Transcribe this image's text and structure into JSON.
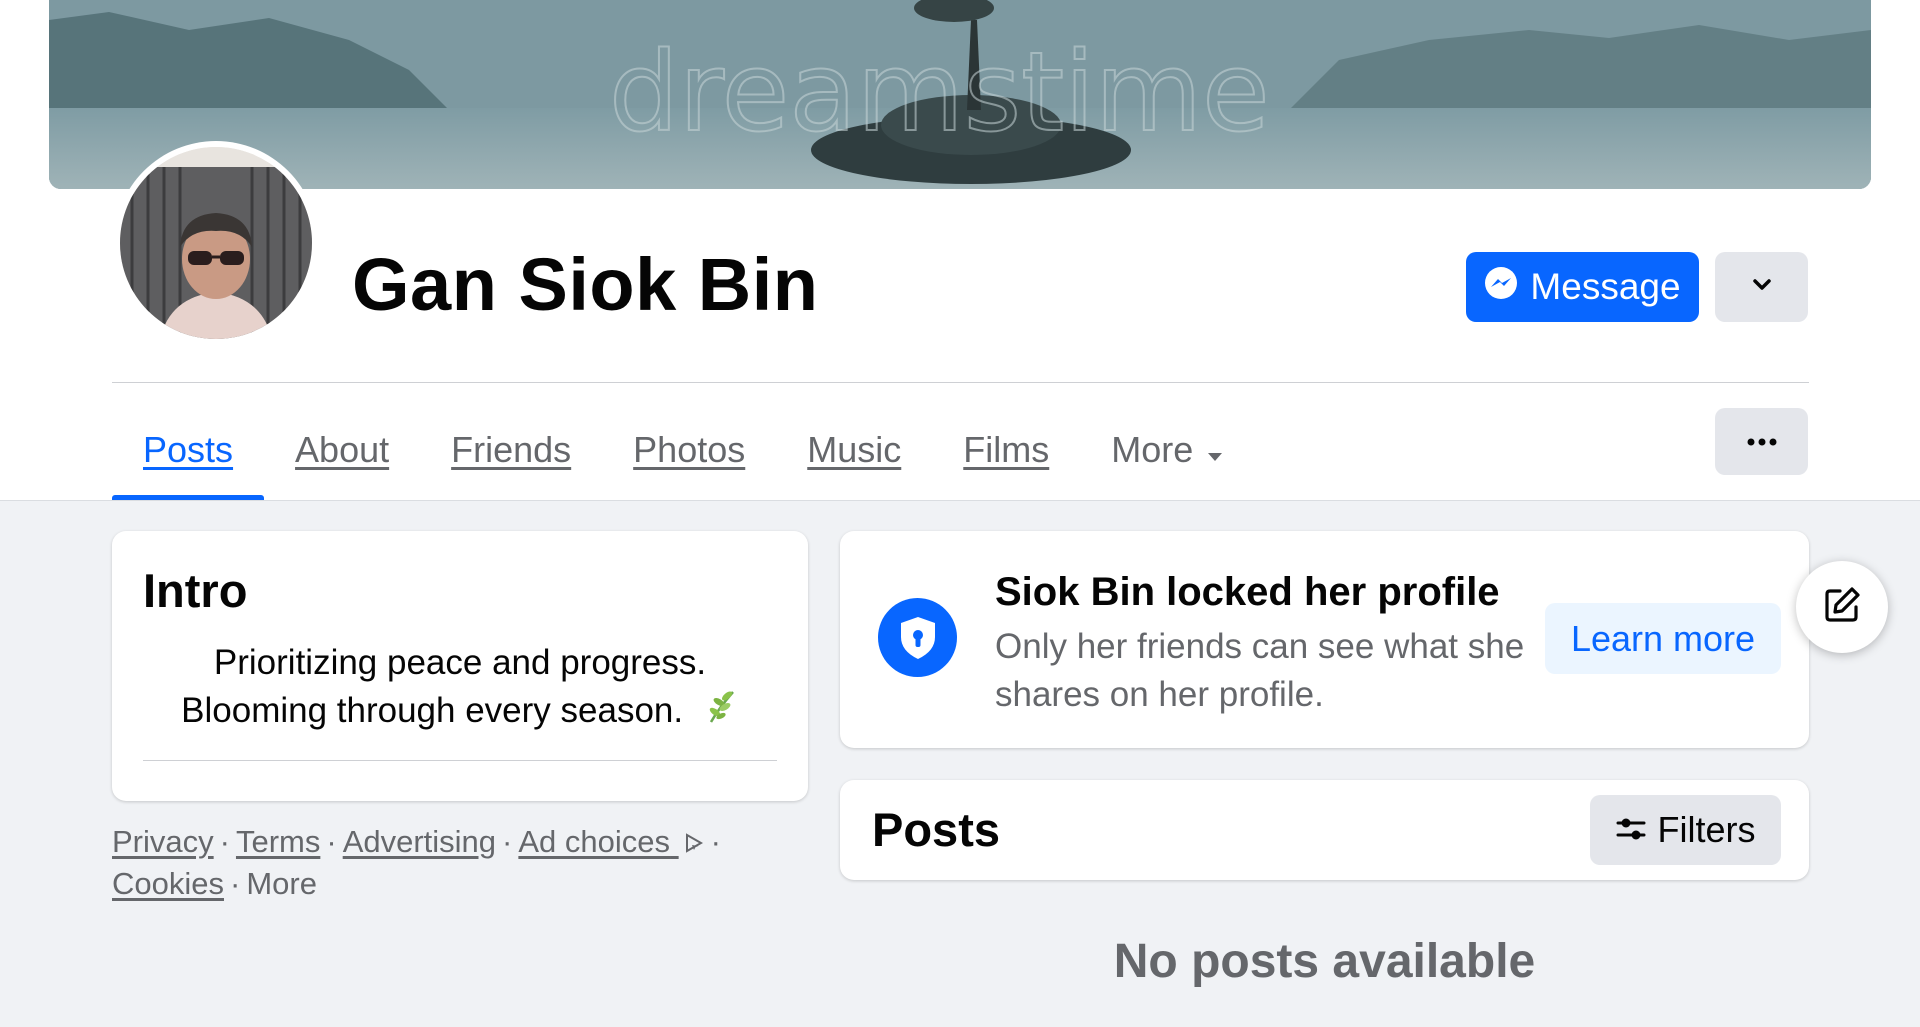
{
  "profile": {
    "name": "Gan Siok Bin",
    "cover_watermark": "dreamstime"
  },
  "actions": {
    "message_label": "Message",
    "message_icon": "messenger-icon",
    "dropdown_icon": "chevron-down-icon",
    "more_options_icon": "ellipsis-icon"
  },
  "tabs": [
    {
      "label": "Posts",
      "active": true
    },
    {
      "label": "About"
    },
    {
      "label": "Friends"
    },
    {
      "label": "Photos"
    },
    {
      "label": "Music"
    },
    {
      "label": "Films"
    },
    {
      "label": "More"
    }
  ],
  "intro": {
    "title": "Intro",
    "bio_line1": "Prioritizing peace and progress.",
    "bio_line2": "Blooming through every season.",
    "bio_emoji": "herb-icon"
  },
  "footer": {
    "links": [
      "Privacy",
      "Terms",
      "Advertising",
      "Ad choices",
      "Cookies"
    ],
    "more": "More",
    "separator": "·"
  },
  "locked": {
    "title": "Siok Bin locked her profile",
    "description": "Only her friends can see what she shares on her profile.",
    "learn_more": "Learn more",
    "icon": "shield-lock-icon"
  },
  "posts": {
    "title": "Posts",
    "filters_label": "Filters",
    "filters_icon": "sliders-icon",
    "empty_text": "No posts available"
  },
  "floating": {
    "icon": "edit-icon"
  },
  "colors": {
    "accent": "#0866ff",
    "page_bg": "#f0f2f5",
    "secondary_text": "#65676b",
    "button_gray": "#e4e6eb",
    "learn_more_bg": "#ebf5ff"
  }
}
